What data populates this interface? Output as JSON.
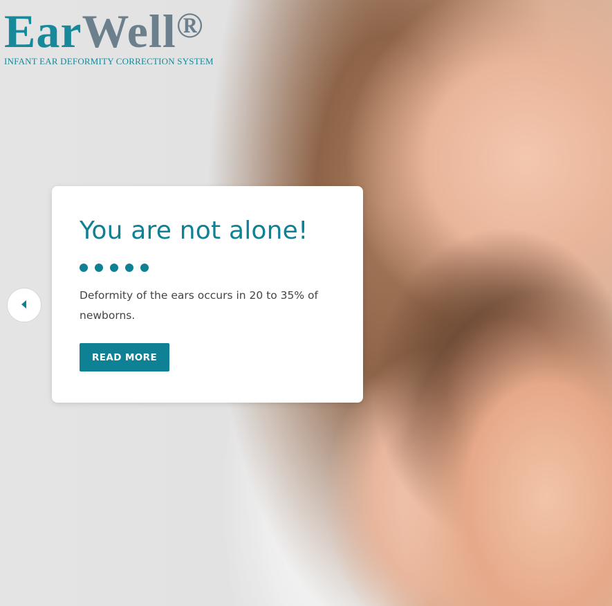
{
  "brand": {
    "name_part1": "Ear",
    "name_part2": "Well",
    "registered": "®",
    "tagline": "INFANT EAR DEFORMITY CORRECTION SYSTEM"
  },
  "slide": {
    "title": "You are not alone!",
    "body": "Deformity of the ears occurs in 20 to 35% of newborns.",
    "cta_label": "READ MORE",
    "indicator_count": 5
  },
  "nav": {
    "prev_icon": "triangle-left-icon"
  },
  "colors": {
    "accent": "#0f8194",
    "brand_teal": "#17899a",
    "brand_slate": "#6b7f8c",
    "card_bg": "#ffffff"
  }
}
